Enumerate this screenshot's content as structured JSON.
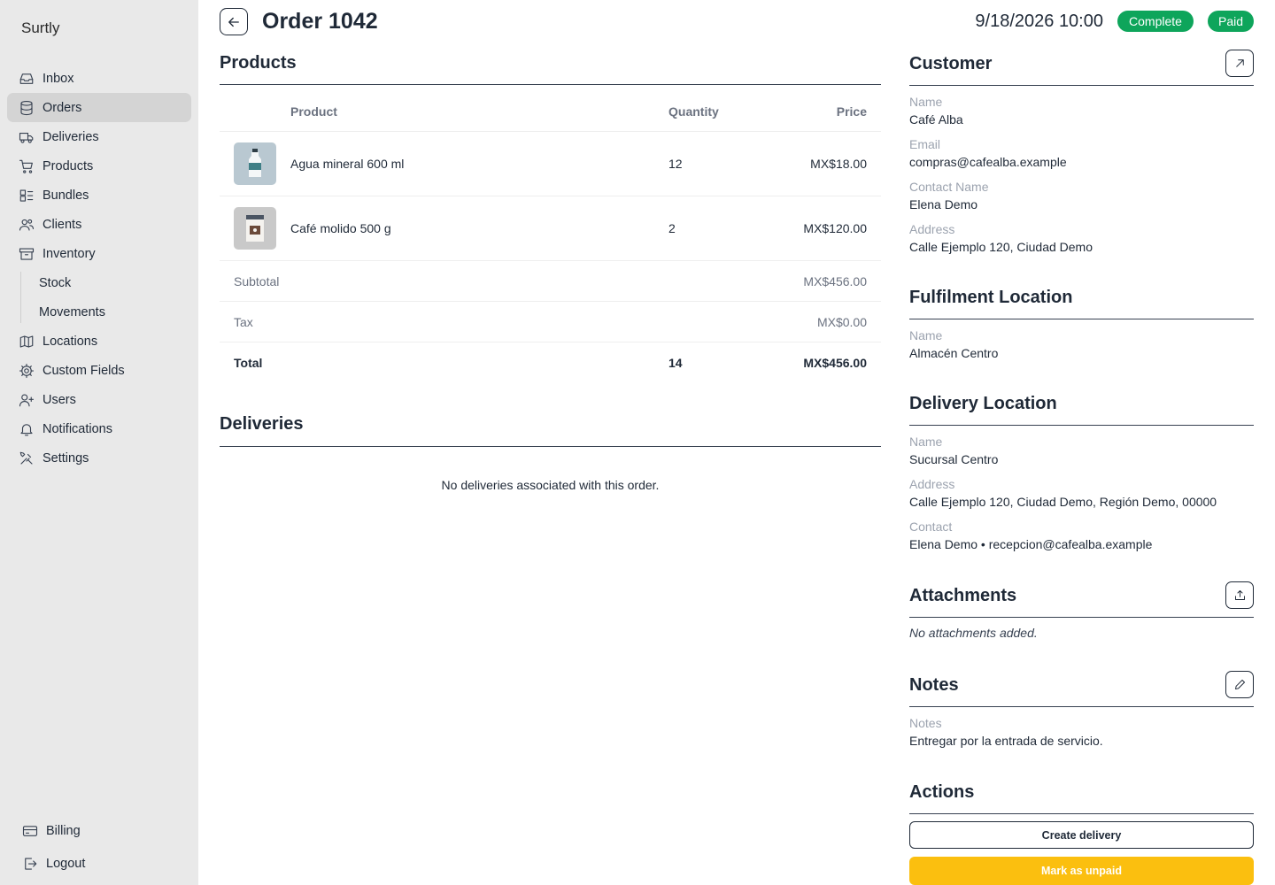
{
  "app": {
    "brand": "Surtly"
  },
  "sidebar": {
    "items": [
      {
        "label": "Inbox",
        "icon": "inbox-icon"
      },
      {
        "label": "Orders",
        "icon": "database-icon",
        "active": true
      },
      {
        "label": "Deliveries",
        "icon": "truck-icon"
      },
      {
        "label": "Products",
        "icon": "cart-icon"
      },
      {
        "label": "Bundles",
        "icon": "bundles-icon"
      },
      {
        "label": "Clients",
        "icon": "users-icon"
      },
      {
        "label": "Inventory",
        "icon": "archive-icon"
      },
      {
        "label": "Stock",
        "sub": true
      },
      {
        "label": "Movements",
        "sub": true
      },
      {
        "label": "Locations",
        "icon": "map-icon"
      },
      {
        "label": "Custom Fields",
        "icon": "cog-icon"
      },
      {
        "label": "Users",
        "icon": "user-plus-icon"
      },
      {
        "label": "Notifications",
        "icon": "bell-icon"
      },
      {
        "label": "Settings",
        "icon": "tools-icon"
      }
    ],
    "bottom": [
      {
        "label": "Billing",
        "icon": "credit-card-icon"
      },
      {
        "label": "Logout",
        "icon": "logout-icon"
      }
    ]
  },
  "header": {
    "title": "Order 1042",
    "datetime": "9/18/2026 10:00",
    "status_badge": "Complete",
    "payment_badge": "Paid",
    "status_color": "#0ea55b"
  },
  "products": {
    "title": "Products",
    "columns": {
      "product": "Product",
      "quantity": "Quantity",
      "price": "Price"
    },
    "rows": [
      {
        "name": "Agua mineral 600 ml",
        "quantity": "12",
        "price": "MX$18.00",
        "thumb": "water-bottle"
      },
      {
        "name": "Café molido 500 g",
        "quantity": "2",
        "price": "MX$120.00",
        "thumb": "coffee-bag"
      }
    ],
    "subtotal_label": "Subtotal",
    "subtotal": "MX$456.00",
    "tax_label": "Tax",
    "tax": "MX$0.00",
    "total_label": "Total",
    "total_quantity": "14",
    "total": "MX$456.00"
  },
  "deliveries": {
    "title": "Deliveries",
    "empty": "No deliveries associated with this order."
  },
  "customer": {
    "title": "Customer",
    "name_label": "Name",
    "name": "Café Alba",
    "email_label": "Email",
    "email": "compras@cafealba.example",
    "contact_label": "Contact Name",
    "contact": "Elena Demo",
    "address_label": "Address",
    "address": "Calle Ejemplo 120, Ciudad Demo"
  },
  "fulfilment": {
    "title": "Fulfilment Location",
    "name_label": "Name",
    "name": "Almacén Centro"
  },
  "delivery_location": {
    "title": "Delivery Location",
    "name_label": "Name",
    "name": "Sucursal Centro",
    "address_label": "Address",
    "address": "Calle Ejemplo 120, Ciudad Demo, Región Demo, 00000",
    "contact_label": "Contact",
    "contact": "Elena Demo • recepcion@cafealba.example"
  },
  "attachments": {
    "title": "Attachments",
    "empty": "No attachments added."
  },
  "notes": {
    "title": "Notes",
    "label": "Notes",
    "value": "Entregar por la entrada de servicio."
  },
  "actions": {
    "title": "Actions",
    "create_delivery": "Create delivery",
    "mark_unpaid": "Mark as unpaid",
    "accent_color": "#fbbf0f"
  }
}
